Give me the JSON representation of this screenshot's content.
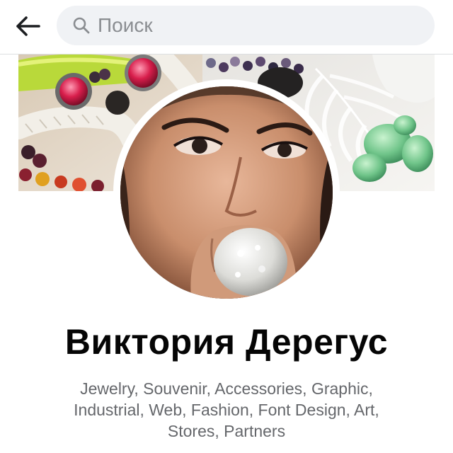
{
  "header": {
    "back_icon": "arrow-left-icon",
    "search": {
      "icon": "search-icon",
      "placeholder": "Поиск",
      "value": ""
    }
  },
  "profile": {
    "name": "Виктория Дерегус",
    "bio_lines": [
      "Jewelry, Souvenir, Accessories, Graphic,",
      "Industrial, Web, Fashion, Font Design, Art,",
      "Stores, Partners"
    ]
  },
  "colors": {
    "text_primary": "#050505",
    "text_secondary": "#65676b",
    "search_bg": "#f0f2f5",
    "divider": "#dddfe2"
  }
}
